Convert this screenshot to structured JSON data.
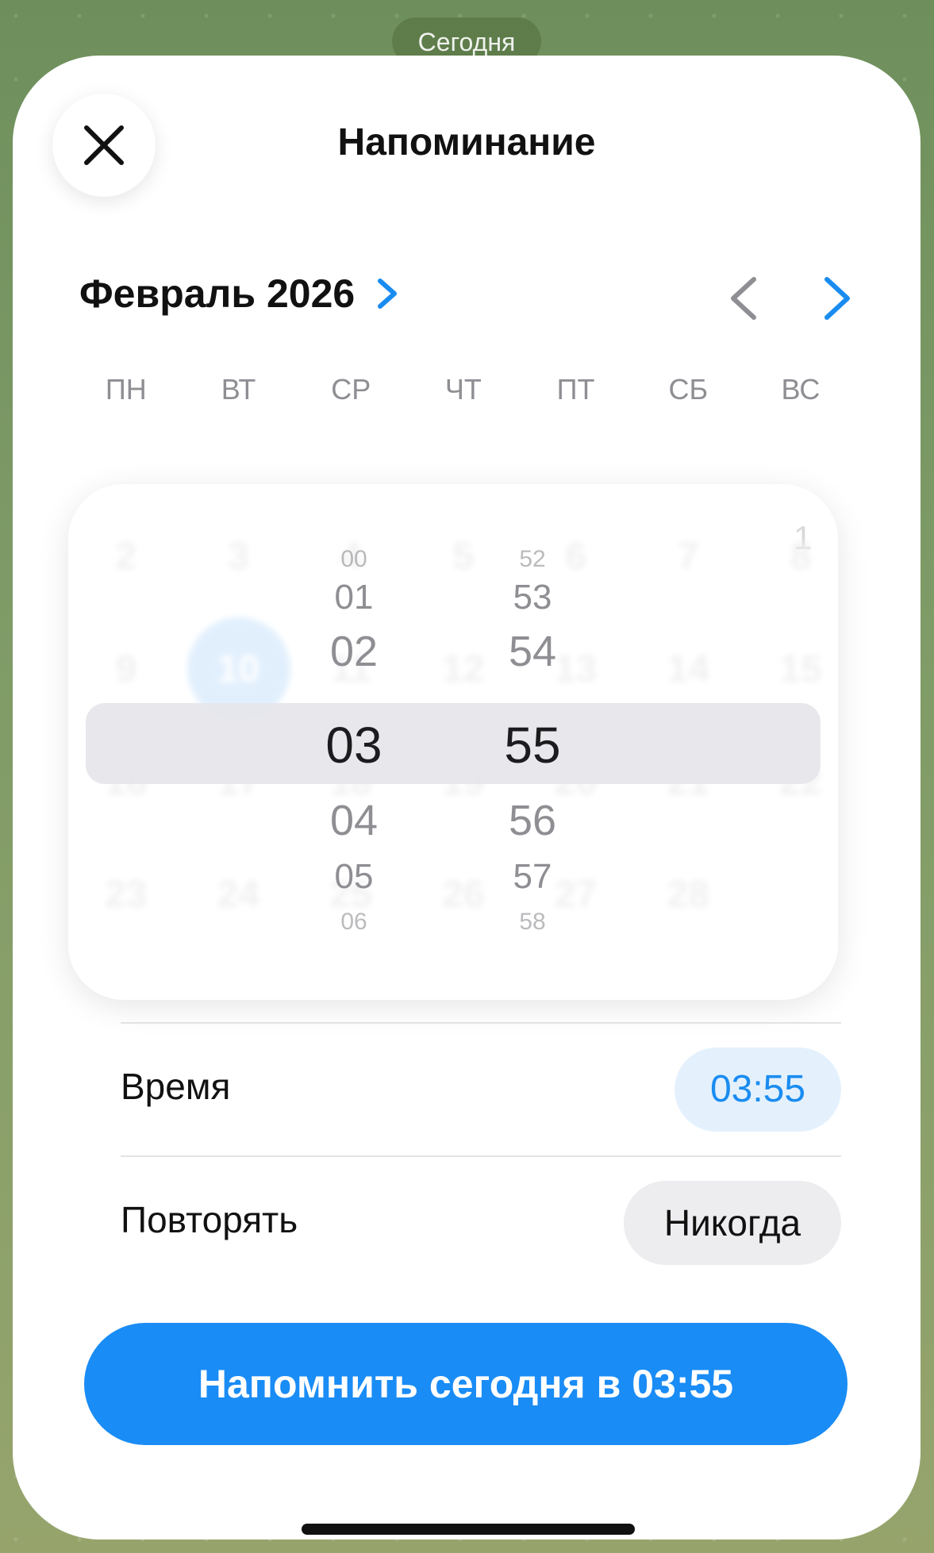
{
  "background": {
    "today_chip": "Сегодня"
  },
  "sheet": {
    "title": "Напоминание",
    "close_icon": "close-icon"
  },
  "calendar": {
    "month_label": "Февраль 2026",
    "weekdays": [
      "ПН",
      "ВТ",
      "СР",
      "ЧТ",
      "ПТ",
      "СБ",
      "ВС"
    ],
    "first_day": "1",
    "weeks": [
      [
        "2",
        "3",
        "4",
        "5",
        "6",
        "7",
        "8"
      ],
      [
        "9",
        "10",
        "11",
        "12",
        "13",
        "14",
        "15"
      ],
      [
        "16",
        "17",
        "18",
        "19",
        "20",
        "21",
        "22"
      ],
      [
        "23",
        "24",
        "25",
        "26",
        "27",
        "28",
        ""
      ]
    ],
    "selected_day": "10",
    "accent_color": "#1a8cf0",
    "selected_color": "#79b8f5"
  },
  "time_picker": {
    "hours": [
      "00",
      "01",
      "02",
      "03",
      "04",
      "05",
      "06"
    ],
    "minutes": [
      "52",
      "53",
      "54",
      "55",
      "56",
      "57",
      "58"
    ],
    "selected_hour": "03",
    "selected_minute": "55"
  },
  "settings": {
    "time_label": "Время",
    "time_value": "03:55",
    "repeat_label": "Повторять",
    "repeat_value": "Никогда"
  },
  "cta": {
    "label": "Напомнить сегодня в 03:55",
    "color": "#1a8cf5"
  }
}
